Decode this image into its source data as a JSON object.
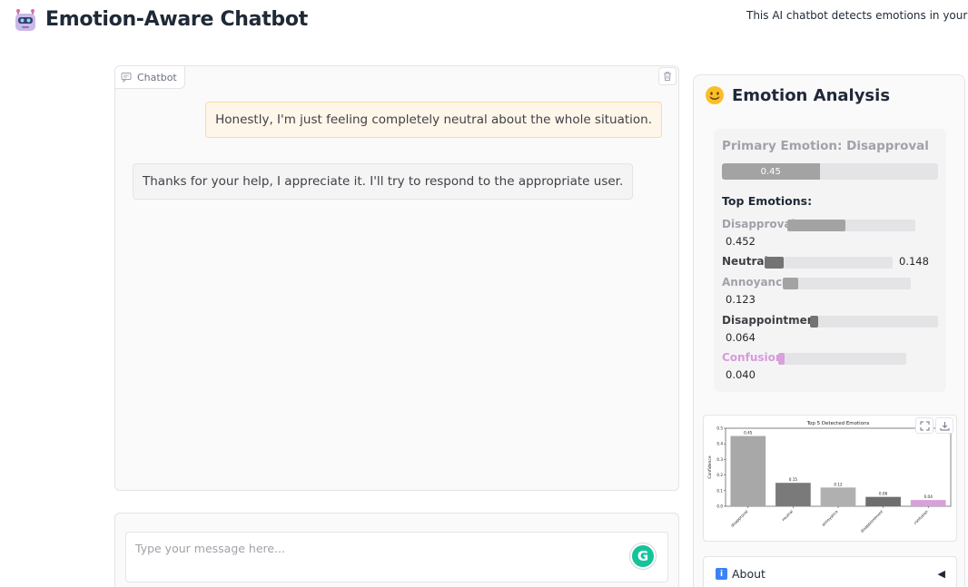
{
  "header": {
    "title": "Emotion-Aware Chatbot",
    "description": "This AI chatbot detects emotions in your mes",
    "icon": "robot-icon"
  },
  "chatbot": {
    "label": "Chatbot",
    "clear_icon": "trash-icon",
    "messages": [
      {
        "role": "user",
        "text": "Honestly, I'm just feeling completely neutral about the whole situation."
      },
      {
        "role": "bot",
        "text": "Thanks for your help, I appreciate it. I'll try to respond to the appropriate user."
      }
    ]
  },
  "input": {
    "placeholder": "Type your message here...",
    "value": "",
    "grammar_badge": "G"
  },
  "emotion_panel": {
    "title": "Emotion Analysis",
    "icon": "smiling-face-icon",
    "primary": {
      "label": "Primary Emotion: Disapproval",
      "value": 0.452,
      "display": "0.45"
    },
    "top_title": "Top Emotions:",
    "emotions": [
      {
        "name": "Disapproval",
        "suffix": ":",
        "value": 0.452,
        "display": "0.452",
        "color": "#a3a3a3",
        "label_color": "#a1a1aa"
      },
      {
        "name": "Neutral",
        "suffix": ":",
        "value": 0.148,
        "display": "0.148",
        "color": "#737373",
        "label_color": "#3f3f46"
      },
      {
        "name": "Annoyance",
        "suffix": ":",
        "value": 0.123,
        "display": "0.123",
        "color": "#a3a3a3",
        "label_color": "#a1a1aa"
      },
      {
        "name": "Disappointment",
        "suffix": ":",
        "value": 0.064,
        "display": "0.064",
        "color": "#737373",
        "label_color": "#3f3f46"
      },
      {
        "name": "Confusion",
        "suffix": ":",
        "value": 0.04,
        "display": "0.040",
        "color": "#d8a0dc",
        "label_color": "#d79bdb"
      }
    ]
  },
  "chart_data": {
    "type": "bar",
    "title": "Top 5 Detected Emotions",
    "xlabel": "",
    "ylabel": "Confidence",
    "categories": [
      "disapproval",
      "neutral",
      "annoyance",
      "disappointment",
      "confusion"
    ],
    "values": [
      0.45,
      0.15,
      0.12,
      0.06,
      0.04
    ],
    "value_labels": [
      "0.45",
      "0.15",
      "0.12",
      "0.06",
      "0.04"
    ],
    "colors": [
      "#a8a8a8",
      "#7a7a7a",
      "#b0b0b0",
      "#6e6e6e",
      "#d8a0dc"
    ],
    "yticks": [
      "0.0",
      "0.1",
      "0.2",
      "0.3",
      "0.4",
      "0.5"
    ],
    "ylim": [
      0,
      0.5
    ]
  },
  "about": {
    "label": "About",
    "icon": "info-icon",
    "caret": "◀"
  }
}
